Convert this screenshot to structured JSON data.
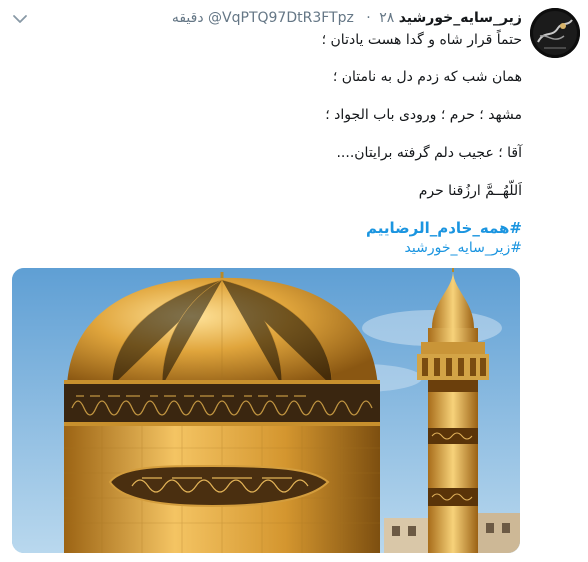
{
  "tweet": {
    "display_name": "زیر_سایه_خورشید",
    "handle": "@VqPTQ97DtR3FTpz",
    "separator": "·",
    "time": "۲۸ دقیقه",
    "lines": [
      "حتماً قرار شاه و گدا هست یادتان ؛",
      "همان شب که زدم دل به نامتان ؛",
      "مشهد ؛ حرم ؛ ورودی باب الجواد ؛",
      "آقا ؛ عجیب دلم گرفته برایتان....",
      "اَللّهُــمَّ ارزُقنا حرم"
    ],
    "hashtags": [
      "#همه_خادم_الرضاییم",
      "#زیر_سایه_خورشید"
    ]
  },
  "icons": {
    "menu": "chevron-down-icon",
    "avatar": "profile-avatar"
  },
  "colors": {
    "link": "#1b95e0",
    "secondary_text": "#657786",
    "primary_text": "#14171a"
  }
}
